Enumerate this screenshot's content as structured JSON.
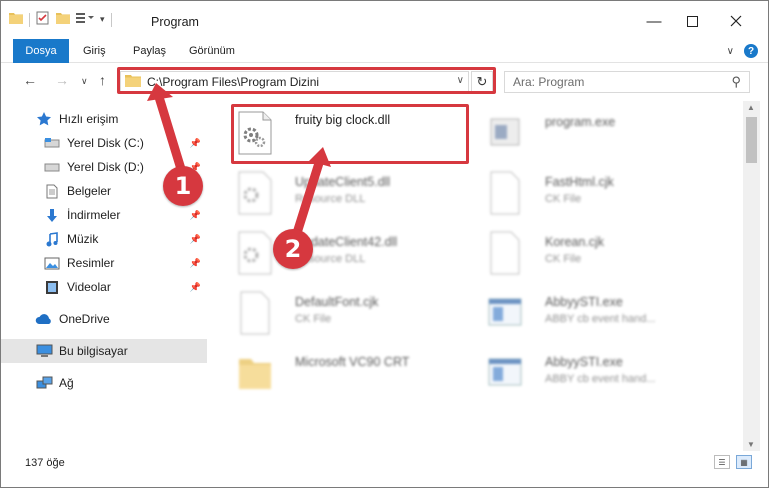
{
  "window": {
    "title": "Program",
    "quick_access_icons": [
      "folder-icon",
      "properties-icon",
      "new-folder-icon",
      "customize-icon"
    ]
  },
  "ribbon": {
    "tabs": [
      {
        "label": "Dosya",
        "active": true
      },
      {
        "label": "Giriş"
      },
      {
        "label": "Paylaş"
      },
      {
        "label": "Görünüm"
      }
    ],
    "accent_color": "#1979ca",
    "help_glyph": "?"
  },
  "navigation": {
    "address_path": "C:\\Program Files\\Program Dizini",
    "search_placeholder": "Ara: Program"
  },
  "sidebar": {
    "items": [
      {
        "label": "Hızlı erişim",
        "icon": "star-icon",
        "pinned": false
      },
      {
        "label": "Yerel Disk (C:)",
        "icon": "drive-icon",
        "pinned": true
      },
      {
        "label": "Yerel Disk (D:)",
        "icon": "drive-icon",
        "pinned": true
      },
      {
        "label": "Belgeler",
        "icon": "document-icon",
        "pinned": true
      },
      {
        "label": "İndirmeler",
        "icon": "download-icon",
        "pinned": true
      },
      {
        "label": "Müzik",
        "icon": "music-icon",
        "pinned": true
      },
      {
        "label": "Resimler",
        "icon": "picture-icon",
        "pinned": true
      },
      {
        "label": "Videolar",
        "icon": "video-icon",
        "pinned": true
      },
      {
        "label": "OneDrive",
        "icon": "cloud-icon",
        "pinned": false
      },
      {
        "label": "Bu bilgisayar",
        "icon": "computer-icon",
        "pinned": false,
        "selected": true
      },
      {
        "label": "Ağ",
        "icon": "network-icon",
        "pinned": false
      }
    ]
  },
  "files": [
    {
      "name": "fruity big clock.dll",
      "type": "",
      "icon": "dll-icon",
      "highlighted": true
    },
    {
      "name": "program.exe",
      "type": "",
      "icon": "exe-icon"
    },
    {
      "name": "UpdateClient5.dll",
      "type": "Resource DLL",
      "icon": "dll-icon"
    },
    {
      "name": "FastHtml.cjk",
      "type": "CK File",
      "icon": "blank-file-icon"
    },
    {
      "name": "UpdateClient42.dll",
      "type": "Resource DLL",
      "icon": "dll-icon"
    },
    {
      "name": "Korean.cjk",
      "type": "CK File",
      "icon": "blank-file-icon"
    },
    {
      "name": "DefaultFont.cjk",
      "type": "CK File",
      "icon": "blank-file-icon"
    },
    {
      "name": "AbbyySTI.exe",
      "type": "ABBY cb event hand...",
      "icon": "app-window-icon"
    },
    {
      "name": "Microsoft VC90 CRT",
      "type": "",
      "icon": "folder-icon"
    },
    {
      "name": "AbbyySTI.exe",
      "type": "ABBY cb event hand...",
      "icon": "app-window-icon"
    }
  ],
  "status": {
    "item_count": "137 öğe"
  },
  "markers": [
    {
      "label": "1",
      "color": "#d6383f"
    },
    {
      "label": "2",
      "color": "#d6383f"
    }
  ]
}
